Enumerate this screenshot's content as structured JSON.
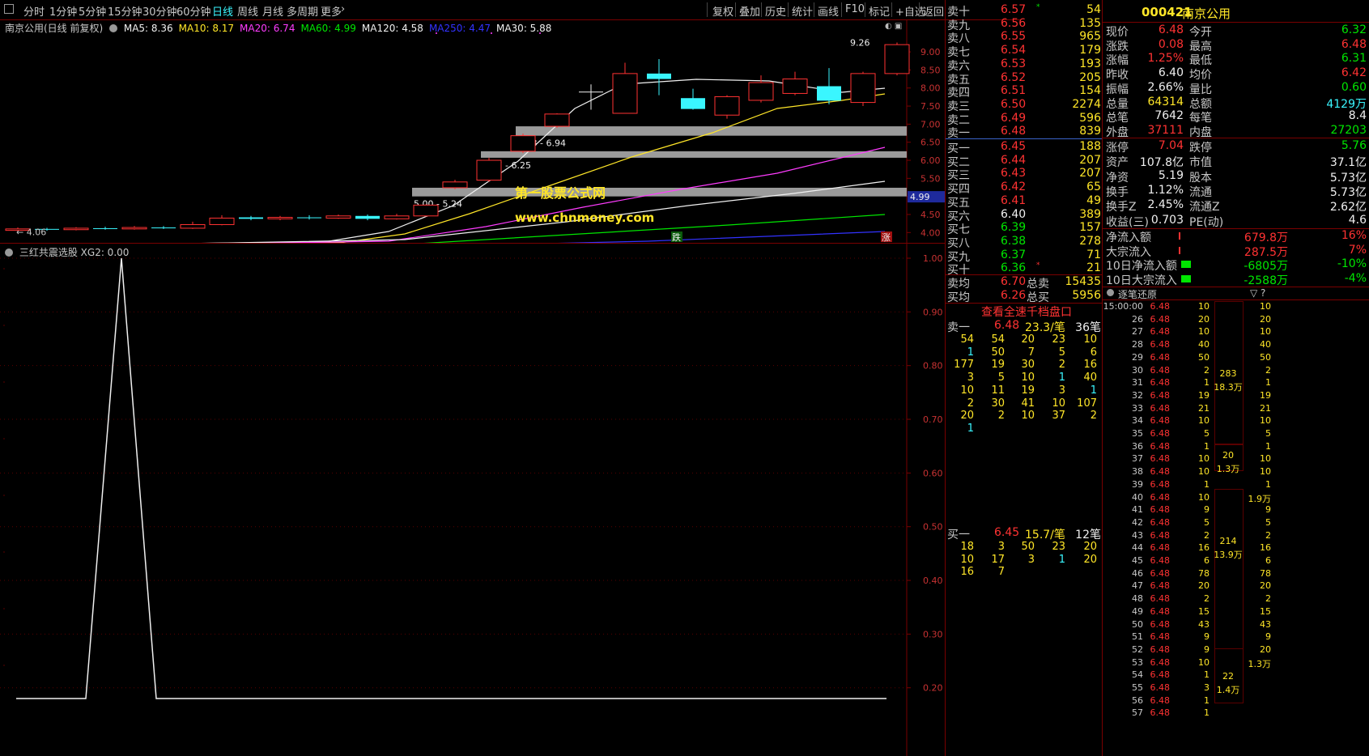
{
  "toolbar": {
    "periods": [
      "分时",
      "1分钟",
      "5分钟",
      "15分钟",
      "30分钟",
      "60分钟",
      "日线",
      "周线",
      "月线",
      "多周期",
      "更多"
    ],
    "active_period": "日线",
    "actions": [
      "复权",
      "叠加",
      "历史",
      "统计",
      "画线",
      "F10",
      "标记",
      "+自选",
      "返回"
    ]
  },
  "chart": {
    "title": "南京公用(日线 前复权)",
    "ma_legend": [
      {
        "label": "MA5: 8.36",
        "color": "#f0f0f0"
      },
      {
        "label": "MA10: 8.17",
        "color": "#ffe628"
      },
      {
        "label": "MA20: 6.74",
        "color": "#ff3cff"
      },
      {
        "label": "MA60: 4.99",
        "color": "#00e600"
      },
      {
        "label": "MA120: 4.58",
        "color": "#f0f0f0"
      },
      {
        "label": "MA250: 4.47",
        "color": "#3232ff"
      },
      {
        "label": "MA30: 5.88",
        "color": "#f0f0f0"
      }
    ],
    "price_axis": [
      "9.00",
      "8.50",
      "8.00",
      "7.50",
      "7.00",
      "6.50",
      "6.00",
      "5.50",
      "5.00",
      "4.50",
      "4.00"
    ],
    "high_label": "9.26",
    "low_label": "4.06",
    "current_price_tag": "4.99",
    "zones": [
      "6.68 - 6.94",
      "6.07 - 6.25",
      "5.00 - 5.24"
    ],
    "watermark_line1": "第一股票公式网",
    "watermark_line2": "www.chnmoney.com",
    "marker_down": "跌",
    "marker_up": "涨",
    "candles": [
      {
        "o": 4.06,
        "c": 4.1,
        "h": 4.14,
        "l": 4.02
      },
      {
        "o": 4.1,
        "c": 4.08,
        "h": 4.13,
        "l": 4.05
      },
      {
        "o": 4.08,
        "c": 4.12,
        "h": 4.15,
        "l": 4.06
      },
      {
        "o": 4.12,
        "c": 4.1,
        "h": 4.16,
        "l": 4.08
      },
      {
        "o": 4.1,
        "c": 4.14,
        "h": 4.18,
        "l": 4.08
      },
      {
        "o": 4.14,
        "c": 4.12,
        "h": 4.18,
        "l": 4.1
      },
      {
        "o": 4.12,
        "c": 4.22,
        "h": 4.3,
        "l": 4.1
      },
      {
        "o": 4.22,
        "c": 4.4,
        "h": 4.48,
        "l": 4.2
      },
      {
        "o": 4.42,
        "c": 4.38,
        "h": 4.46,
        "l": 4.34
      },
      {
        "o": 4.38,
        "c": 4.42,
        "h": 4.46,
        "l": 4.34
      },
      {
        "o": 4.42,
        "c": 4.4,
        "h": 4.48,
        "l": 4.36
      },
      {
        "o": 4.4,
        "c": 4.46,
        "h": 4.5,
        "l": 4.38
      },
      {
        "o": 4.46,
        "c": 4.38,
        "h": 4.5,
        "l": 4.34
      },
      {
        "o": 4.38,
        "c": 4.46,
        "h": 4.52,
        "l": 4.36
      },
      {
        "o": 4.46,
        "c": 4.76,
        "h": 4.78,
        "l": 4.44
      },
      {
        "o": 5.24,
        "c": 5.4,
        "h": 5.46,
        "l": 5.2
      },
      {
        "o": 5.45,
        "c": 6.0,
        "h": 6.07,
        "l": 5.4
      },
      {
        "o": 6.25,
        "c": 6.68,
        "h": 6.74,
        "l": 6.2
      },
      {
        "o": 6.94,
        "c": 7.28,
        "h": 7.3,
        "l": 6.9
      },
      {
        "o": 7.9,
        "c": 7.9,
        "h": 8.1,
        "l": 7.4
      },
      {
        "o": 7.3,
        "c": 8.4,
        "h": 8.7,
        "l": 7.3
      },
      {
        "o": 8.4,
        "c": 8.25,
        "h": 8.8,
        "l": 7.8
      },
      {
        "o": 7.72,
        "c": 7.42,
        "h": 7.98,
        "l": 7.4
      },
      {
        "o": 7.25,
        "c": 7.76,
        "h": 7.8,
        "l": 7.15
      },
      {
        "o": 7.66,
        "c": 8.15,
        "h": 8.35,
        "l": 7.6
      },
      {
        "o": 7.85,
        "c": 8.25,
        "h": 8.45,
        "l": 7.8
      },
      {
        "o": 8.05,
        "c": 7.65,
        "h": 8.55,
        "l": 7.55
      },
      {
        "o": 7.6,
        "c": 8.4,
        "h": 8.45,
        "l": 7.5
      },
      {
        "o": 8.4,
        "c": 9.2,
        "h": 9.26,
        "l": 8.35
      }
    ]
  },
  "indicator": {
    "title": "三红共震选股",
    "value_label": "XG2: 0.00",
    "axis": [
      "1.00",
      "0.90",
      "0.80",
      "0.70",
      "0.60",
      "0.50",
      "0.40",
      "0.30",
      "0.20"
    ]
  },
  "orderbook": {
    "asks": [
      {
        "label": "卖十",
        "price": "6.57",
        "vol": "54",
        "mark": "*"
      },
      {
        "label": "卖九",
        "price": "6.56",
        "vol": "135",
        "mark": ""
      },
      {
        "label": "卖八",
        "price": "6.55",
        "vol": "965",
        "mark": ""
      },
      {
        "label": "卖七",
        "price": "6.54",
        "vol": "179",
        "mark": ""
      },
      {
        "label": "卖六",
        "price": "6.53",
        "vol": "193",
        "mark": ""
      },
      {
        "label": "卖五",
        "price": "6.52",
        "vol": "205",
        "mark": ""
      },
      {
        "label": "卖四",
        "price": "6.51",
        "vol": "154",
        "mark": ""
      },
      {
        "label": "卖三",
        "price": "6.50",
        "vol": "2274",
        "mark": ""
      },
      {
        "label": "卖二",
        "price": "6.49",
        "vol": "596",
        "mark": ""
      },
      {
        "label": "卖一",
        "price": "6.48",
        "vol": "839",
        "mark": ""
      }
    ],
    "bids": [
      {
        "label": "买一",
        "price": "6.45",
        "vol": "188",
        "mark": ""
      },
      {
        "label": "买二",
        "price": "6.44",
        "vol": "207",
        "mark": ""
      },
      {
        "label": "买三",
        "price": "6.43",
        "vol": "207",
        "mark": ""
      },
      {
        "label": "买四",
        "price": "6.42",
        "vol": "65",
        "mark": ""
      },
      {
        "label": "买五",
        "price": "6.41",
        "vol": "49",
        "mark": ""
      },
      {
        "label": "买六",
        "price": "6.40",
        "vol": "389",
        "mark": ""
      },
      {
        "label": "买七",
        "price": "6.39",
        "vol": "157",
        "mark": ""
      },
      {
        "label": "买八",
        "price": "6.38",
        "vol": "278",
        "mark": ""
      },
      {
        "label": "买九",
        "price": "6.37",
        "vol": "71",
        "mark": ""
      },
      {
        "label": "买十",
        "price": "6.36",
        "vol": "21",
        "mark": "*"
      }
    ],
    "avg_sell_label": "卖均",
    "avg_sell": "6.70",
    "total_sell_label": "总卖",
    "total_sell": "15435",
    "avg_buy_label": "买均",
    "avg_buy": "6.26",
    "total_buy_label": "总买",
    "total_buy": "5956",
    "link": "查看全速千档盘口",
    "sell1": {
      "label": "卖一",
      "price": "6.48",
      "avg": "23.3/笔",
      "count": "36笔"
    },
    "sell1_queue": [
      [
        "54",
        "54",
        "20",
        "23",
        "10"
      ],
      [
        "1",
        "50",
        "7",
        "5",
        "6"
      ],
      [
        "177",
        "19",
        "30",
        "2",
        "16"
      ],
      [
        "3",
        "5",
        "10",
        "1",
        "40"
      ],
      [
        "10",
        "11",
        "19",
        "3",
        "1"
      ],
      [
        "2",
        "30",
        "41",
        "10",
        "107"
      ],
      [
        "20",
        "2",
        "10",
        "37",
        "2"
      ],
      [
        "1"
      ]
    ],
    "buy1": {
      "label": "买一",
      "price": "6.45",
      "avg": "15.7/笔",
      "count": "12笔"
    },
    "buy1_queue": [
      [
        "18",
        "3",
        "50",
        "23",
        "20"
      ],
      [
        "10",
        "17",
        "3",
        "1",
        "20"
      ],
      [
        "16",
        "7"
      ]
    ]
  },
  "quote": {
    "code": "000421",
    "name": "南京公用",
    "rows": [
      [
        "现价",
        "6.48",
        "今开",
        "6.32"
      ],
      [
        "涨跌",
        "0.08",
        "最高",
        "6.48"
      ],
      [
        "涨幅",
        "1.25%",
        "最低",
        "6.31"
      ],
      [
        "昨收",
        "6.40",
        "均价",
        "6.42"
      ],
      [
        "振幅",
        "2.66%",
        "量比",
        "0.60"
      ],
      [
        "总量",
        "64314",
        "总额",
        "4129万"
      ],
      [
        "总笔",
        "7642",
        "每笔",
        "8.4"
      ],
      [
        "外盘",
        "37111",
        "内盘",
        "27203"
      ]
    ],
    "rows2": [
      [
        "涨停",
        "7.04",
        "跌停",
        "5.76"
      ],
      [
        "资产",
        "107.8亿",
        "市值",
        "37.1亿"
      ],
      [
        "净资",
        "5.19",
        "股本",
        "5.73亿"
      ],
      [
        "换手",
        "1.12%",
        "流通",
        "5.73亿"
      ],
      [
        "换手Z",
        "2.45%",
        "流通Z",
        "2.62亿"
      ],
      [
        "收益(三)",
        "0.703",
        "PE(动)",
        "4.6"
      ]
    ],
    "flows": [
      [
        "净流入额",
        "679.8万",
        "16%"
      ],
      [
        "大宗流入",
        "287.5万",
        "7%"
      ],
      [
        "10日净流入额",
        "-6805万",
        "-10%"
      ],
      [
        "10日大宗流入",
        "-2588万",
        "-4%"
      ]
    ]
  },
  "ticks": {
    "title": "逐笔还原",
    "rows": [
      [
        "15:00:00",
        "6.48",
        "10"
      ],
      [
        "26",
        "6.48",
        "20"
      ],
      [
        "27",
        "6.48",
        "10"
      ],
      [
        "28",
        "6.48",
        "40"
      ],
      [
        "29",
        "6.48",
        "50"
      ],
      [
        "30",
        "6.48",
        "2"
      ],
      [
        "31",
        "6.48",
        "1"
      ],
      [
        "32",
        "6.48",
        "19"
      ],
      [
        "33",
        "6.48",
        "21"
      ],
      [
        "34",
        "6.48",
        "10"
      ],
      [
        "35",
        "6.48",
        "5"
      ],
      [
        "36",
        "6.48",
        "1"
      ],
      [
        "37",
        "6.48",
        "10"
      ],
      [
        "38",
        "6.48",
        "10"
      ],
      [
        "39",
        "6.48",
        "1"
      ],
      [
        "40",
        "6.48",
        "10"
      ],
      [
        "41",
        "6.48",
        "9"
      ],
      [
        "42",
        "6.48",
        "5"
      ],
      [
        "43",
        "6.48",
        "2"
      ],
      [
        "44",
        "6.48",
        "16"
      ],
      [
        "45",
        "6.48",
        "6"
      ],
      [
        "46",
        "6.48",
        "78"
      ],
      [
        "47",
        "6.48",
        "20"
      ],
      [
        "48",
        "6.48",
        "2"
      ],
      [
        "49",
        "6.48",
        "15"
      ],
      [
        "50",
        "6.48",
        "43"
      ],
      [
        "51",
        "6.48",
        "9"
      ],
      [
        "52",
        "6.48",
        "9"
      ],
      [
        "53",
        "6.48",
        "10"
      ],
      [
        "54",
        "6.48",
        "1"
      ],
      [
        "55",
        "6.48",
        "3"
      ],
      [
        "56",
        "6.48",
        "1"
      ],
      [
        "57",
        "6.48",
        "1"
      ]
    ],
    "groups": [
      {
        "count": "283",
        "amount": "18.3万"
      },
      {
        "count": "20",
        "amount": "1.3万"
      },
      {
        "count": "214",
        "amount": "13.9万"
      },
      {
        "count": "22",
        "amount": "1.4万"
      }
    ],
    "col2": [
      "10",
      "20",
      "10",
      "40",
      "50",
      "2",
      "1",
      "19",
      "21",
      "10",
      "5",
      "1",
      "10",
      "10",
      "1",
      "1.9万",
      "9",
      "5",
      "2",
      "16",
      "6",
      "78",
      "20",
      "2",
      "15",
      "43",
      "9",
      "20",
      "1.3万"
    ]
  }
}
